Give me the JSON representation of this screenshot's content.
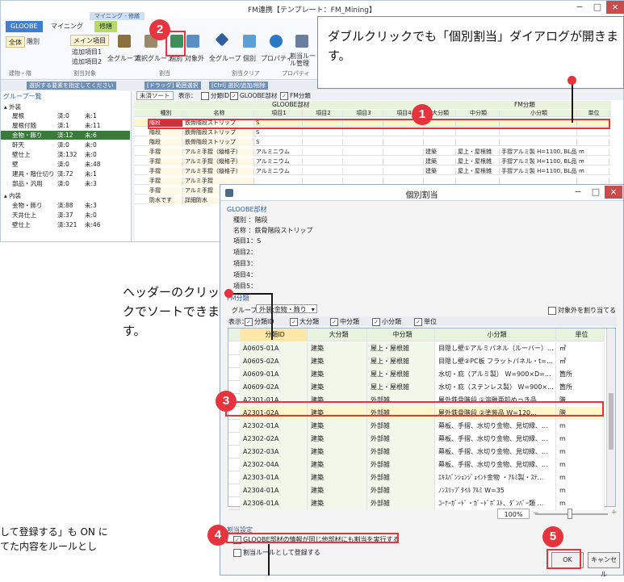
{
  "app": {
    "title": "FM連携【テンプレート：FM_Mining】",
    "tabs": [
      "GLOOBE",
      "マイニング",
      "修繕"
    ],
    "context_tab": "マイニング - 修繕",
    "window_controls": [
      "−",
      "□",
      "×"
    ]
  },
  "ribbon": {
    "scope_all": "全体",
    "scope_type": "階別",
    "main_item": "メイン項目",
    "add_item1": "追加項目1",
    "add_item2": "追加項目2",
    "btn_all_group": "全グループ",
    "btn_select_group": "選択グループ",
    "btn_individual": "個別",
    "btn_excluded": "対象外",
    "btn_all_group2": "全グループ",
    "btn_individual2": "個別",
    "btn_property": "プロパティ",
    "btn_rule": "割当ルール管理",
    "btn_property2": "プロパティ",
    "groups": [
      "建物・階",
      "割当対象",
      "割当",
      "割当クリア",
      "プロパティ"
    ]
  },
  "hint_bar": {
    "hint1": "選択する要素を指定してください",
    "hint2": "[ドラッグ] 範囲選択",
    "hint3": "[Ctrl] 選択/追加/削除"
  },
  "tree": {
    "title": "グループ一覧",
    "cat_exterior": "外装",
    "cat_interior": "内装",
    "items": [
      {
        "name": "屋根",
        "done": "済:0",
        "undone": "未:1"
      },
      {
        "name": "屋根付随",
        "done": "済:1",
        "undone": "未:11"
      },
      {
        "name": "金物・飾り",
        "done": "済:12",
        "undone": "未:6"
      },
      {
        "name": "軒天",
        "done": "済:0",
        "undone": "未:0"
      },
      {
        "name": "壁仕上",
        "done": "済:132",
        "undone": "未:0"
      },
      {
        "name": "壁",
        "done": "済:0",
        "undone": "未:48"
      },
      {
        "name": "建具・階仕切り",
        "done": "済:72",
        "undone": "未:1"
      },
      {
        "name": "部品・汎用",
        "done": "済:0",
        "undone": "未:3"
      }
    ],
    "items_interior": [
      {
        "name": "金物・飾り",
        "done": "済:88",
        "undone": "未:3"
      },
      {
        "name": "天井仕上",
        "done": "済:37",
        "undone": "未:0"
      },
      {
        "name": "壁仕上",
        "done": "済:321",
        "undone": "未:46"
      }
    ]
  },
  "grid1": {
    "toolbar_sort": "未済ソート",
    "toolbar_display": "表示：",
    "chk_class_id": "分類ID",
    "chk_gloobe": "GLOOBE部材",
    "chk_fm": "FM分類",
    "group_gloobe": "GLOOBE部材",
    "group_fm": "FM分類",
    "headers": [
      "種別",
      "名称",
      "項目1",
      "項目2",
      "項目3",
      "項目4",
      "大分類",
      "中分類",
      "小分類",
      "単位"
    ],
    "rows": [
      [
        "階段",
        "鉄骨階段ストリップ",
        "S",
        "",
        "",
        "",
        "",
        "",
        "",
        ""
      ],
      [
        "階段",
        "鉄骨階段ストリップ",
        "S",
        "",
        "",
        "",
        "",
        "",
        "",
        ""
      ],
      [
        "階段",
        "鉄骨階段ストリップ",
        "S",
        "",
        "",
        "",
        "",
        "",
        "",
        ""
      ],
      [
        "手摺",
        "アルミ手摺（縦格子）",
        "アルミニウム",
        "",
        "",
        "",
        "建築",
        "屋上・屋根雑",
        "手摺アルミ製 H=1100, BL品",
        "m"
      ],
      [
        "手摺",
        "アルミ手摺（縦格子）",
        "アルミニウム",
        "",
        "",
        "",
        "建築",
        "屋上・屋根雑",
        "手摺アルミ製 H=1100, BL品",
        "m"
      ],
      [
        "手摺",
        "アルミ手摺（縦格子）",
        "アルミニウム",
        "",
        "",
        "",
        "建築",
        "屋上・屋根雑",
        "手摺アルミ製 H=1100, BL品",
        "m"
      ],
      [
        "手摺",
        "アルミ手摺",
        "",
        "",
        "",
        "",
        "",
        "",
        "",
        ""
      ],
      [
        "手摺",
        "アルミ手摺",
        "",
        "",
        "",
        "",
        "",
        "",
        "",
        ""
      ],
      [
        "防水です",
        "詳細防水",
        "",
        "",
        "",
        "",
        "",
        "",
        "",
        ""
      ]
    ]
  },
  "callouts": {
    "double_click": "ダブルクリックでも「個別割当」ダイアログが開きます。",
    "sort_header": "ヘッダーのクリックでソートできます。",
    "bottom_line1": "して登録する」も ON に",
    "bottom_line2": "てた内容をルールとし",
    "badges": [
      "1",
      "2",
      "3",
      "4",
      "5"
    ]
  },
  "dialog": {
    "title": "個別割当",
    "section_gloobe": "GLOOBE部材",
    "kind": "種別 ：階段",
    "name": "名称 ：鉄骨階段ストリップ",
    "item1": "項目1：S",
    "item2": "項目2：",
    "item3": "項目3：",
    "item4": "項目4：",
    "item5": "項目5：",
    "section_fm": "FM分類",
    "group_label": "グループ",
    "group_value": "外装:金物・飾り",
    "assign_excluded": "対象外を割り当てる",
    "display_label": "表示：",
    "chk_labels": [
      "分類ID",
      "大分類",
      "中分類",
      "小分類",
      "単位"
    ],
    "headers": [
      "分類ID",
      "大分類",
      "中分類",
      "小分類",
      "単位"
    ],
    "rows": [
      [
        "A0605-01A",
        "建築",
        "屋上・屋根雑",
        "目隠し壁①アルミパネル（ルーバー）...",
        "㎡"
      ],
      [
        "A0605-02A",
        "建築",
        "屋上・屋根雑",
        "目隠し壁②PC板 フラットパネル・t=5...",
        "㎡"
      ],
      [
        "A0609-01A",
        "建築",
        "屋上・屋根雑",
        "水切・庇（アルミ製） W=900×D=...",
        "箇所"
      ],
      [
        "A0609-02A",
        "建築",
        "屋上・屋根雑",
        "水切・庇（ステンレス製） W=900×...",
        "箇所"
      ],
      [
        "A2301-01A",
        "建築",
        "外部雑",
        "屋外鉄骨階段 ①溶融亜鉛めっき品...",
        "階"
      ],
      [
        "A2301-02A",
        "建築",
        "外部雑",
        "屋外鉄骨階段 ②塗装品 W=120...",
        "階"
      ],
      [
        "A2302-01A",
        "建築",
        "外部雑",
        "幕板、手摺、水切り金物、見切縁、...",
        "m"
      ],
      [
        "A2302-02A",
        "建築",
        "外部雑",
        "幕板、手摺、水切り金物、見切縁、...",
        "m"
      ],
      [
        "A2302-03A",
        "建築",
        "外部雑",
        "幕板、手摺、水切り金物、見切縁、...",
        "m"
      ],
      [
        "A2302-04A",
        "建築",
        "外部雑",
        "幕板、手摺、水切り金物、見切縁、...",
        "m"
      ],
      [
        "A2303-01A",
        "建築",
        "外部雑",
        "ｴｷｽﾊﾟﾝｼｮﾝｼﾞｮｲﾝﾄ金物 ・ｱﾙﾐ製・ｽﾃ...",
        "m"
      ],
      [
        "A2304-01A",
        "建築",
        "外部雑",
        "ﾉﾝｽﾘｯﾌﾟﾀｲﾙ ｱﾙﾐ W=35",
        "m"
      ],
      [
        "A2306-01A",
        "建築",
        "外部雑",
        "ｺｰﾅｰｶﾞｰﾄﾞ・ｶﾞｰﾄﾞﾎﾟｽﾄ、ﾀﾞﾝﾊﾟｰ類 ...",
        "m"
      ]
    ],
    "zoom": "100%",
    "section_assign": "割当設定",
    "chk_same_member": "GLOOBE部材の情報が同じ他部材にも割当を実行する",
    "chk_rule": "割当ルールとして登録する",
    "ok": "OK",
    "cancel": "キャンセル"
  },
  "colors": {
    "accent": "#e5343d",
    "selected_row": "#fdf6c9",
    "header_green": "#e8f3de",
    "ribbon_blue": "#3f7fd0"
  }
}
